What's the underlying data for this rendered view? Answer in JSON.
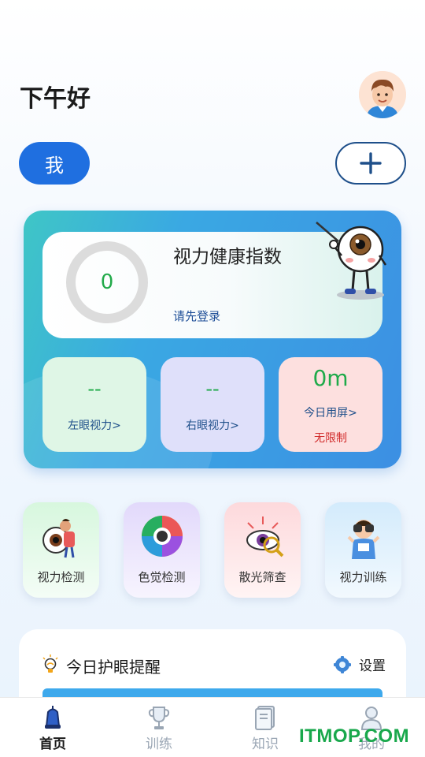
{
  "header": {
    "greeting": "下午好",
    "me_button": "我",
    "add_icon": "plus-icon"
  },
  "health": {
    "title": "视力健康指数",
    "score": "0",
    "login_hint": "请先登录",
    "left_eye": {
      "value": "--",
      "label": "左眼视力>"
    },
    "right_eye": {
      "value": "--",
      "label": "右眼视力>"
    },
    "screen_time": {
      "value": "0m",
      "label": "今日用屏>",
      "limit": "无限制"
    }
  },
  "tools": [
    {
      "label": "视力检测",
      "icon": "eye-exam-icon"
    },
    {
      "label": "色觉检测",
      "icon": "color-wheel-icon"
    },
    {
      "label": "散光筛查",
      "icon": "astigmatism-icon"
    },
    {
      "label": "视力训练",
      "icon": "binoculars-kid-icon"
    }
  ],
  "reminder": {
    "title": "今日护眼提醒",
    "settings_label": "设置"
  },
  "bottom_nav": [
    {
      "label": "首页",
      "icon": "home-icon",
      "active": true
    },
    {
      "label": "训练",
      "icon": "trophy-icon",
      "active": false
    },
    {
      "label": "知识",
      "icon": "book-icon",
      "active": false
    },
    {
      "label": "我的",
      "icon": "user-icon",
      "active": false
    }
  ],
  "watermark": "ITMOP.COM",
  "colors": {
    "primary": "#1f6fe0",
    "score_green": "#1faa4a",
    "warning_red": "#d12a2a",
    "label_blue": "#1e4f8a"
  }
}
